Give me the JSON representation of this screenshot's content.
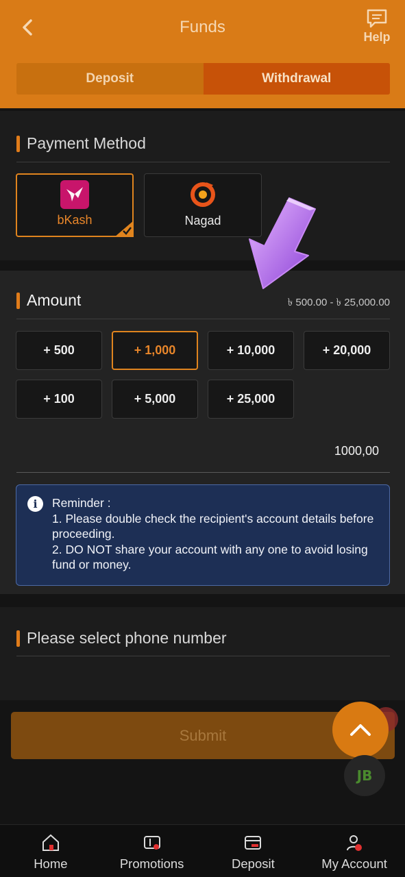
{
  "header": {
    "title": "Funds",
    "help_label": "Help",
    "tabs": [
      {
        "label": "Deposit",
        "active": false
      },
      {
        "label": "Withdrawal",
        "active": true
      }
    ]
  },
  "payment": {
    "title": "Payment Method",
    "methods": [
      {
        "label": "bKash",
        "icon": "bkash-logo",
        "selected": true
      },
      {
        "label": "Nagad",
        "icon": "nagad-logo",
        "selected": false
      }
    ]
  },
  "amount": {
    "title": "Amount",
    "range": "৳ 500.00 - ৳ 25,000.00",
    "chips": [
      "+ 500",
      "+ 1,000",
      "+ 10,000",
      "+ 20,000",
      "+ 100",
      "+ 5,000",
      "+ 25,000"
    ],
    "active_chip": "+ 1,000",
    "value": "1000,00"
  },
  "reminder": {
    "title": "Reminder :",
    "line1": "1. Please double check the recipient's account details before proceeding.",
    "line2": "2. DO NOT share your account with any one to avoid losing fund or money."
  },
  "phone": {
    "title": "Please select phone number"
  },
  "submit_label": "Submit",
  "fab_logo_text": "JB",
  "nav": {
    "items": [
      {
        "label": "Home",
        "icon": "home-icon"
      },
      {
        "label": "Promotions",
        "icon": "promotions-icon"
      },
      {
        "label": "Deposit",
        "icon": "deposit-icon"
      },
      {
        "label": "My Account",
        "icon": "account-icon"
      }
    ]
  },
  "colors": {
    "accent": "#d97b17",
    "selected_border": "#e0841e",
    "reminder_bg": "#1d2f55"
  }
}
